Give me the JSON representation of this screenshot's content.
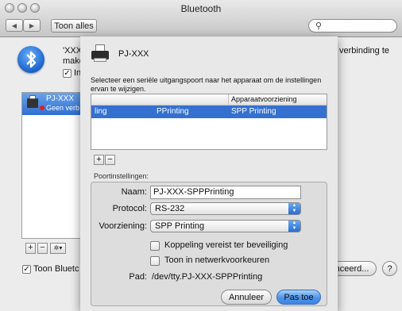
{
  "window": {
    "title": "Bluetooth",
    "show_all_label": "Toon alles",
    "search_placeholder": ""
  },
  "background": {
    "message_line1": "'XXX",
    "message_line1_tail": "verbinding te",
    "message_line2": "make",
    "checkbox_label_fragment": "In",
    "device": {
      "name": "PJ-XXX",
      "status": "Geen verb"
    },
    "show_bluetooth_label": "Toon Bluetc",
    "advanced_button_label": "nceerd...",
    "help_label": "?",
    "add_label": "+",
    "remove_label": "−",
    "action_label": "✲▾"
  },
  "sheet": {
    "device_title": "PJ-XXX",
    "description": "Selecteer een seriële uitgangspoort naar het apparaat om de instellingen ervan te wijzigen.",
    "table": {
      "columns": [
        "",
        "Apparaatvoorziening"
      ],
      "rows": [
        {
          "port": "PPrinting",
          "service": "SPP Printing",
          "fragment": "ling"
        }
      ]
    },
    "add_label": "+",
    "remove_label": "−",
    "port_settings_label": "Poortinstellingen:",
    "fields": {
      "name_label": "Naam:",
      "name_value": "PJ-XXX-SPPPrinting",
      "protocol_label": "Protocol:",
      "protocol_value": "RS-232",
      "service_label": "Voorziening:",
      "service_value": "SPP Printing",
      "pairing_label": "Koppeling vereist ter beveiliging",
      "show_in_network_label": "Toon in netwerkvoorkeuren",
      "path_label": "Pad:",
      "path_value": "/dev/tty.PJ-XXX-SPPPrinting"
    },
    "cancel_label": "Annuleer",
    "ok_label": "Pas toe"
  },
  "colors": {
    "selection": "#3470d0",
    "primary_button": "#4c93ea"
  }
}
